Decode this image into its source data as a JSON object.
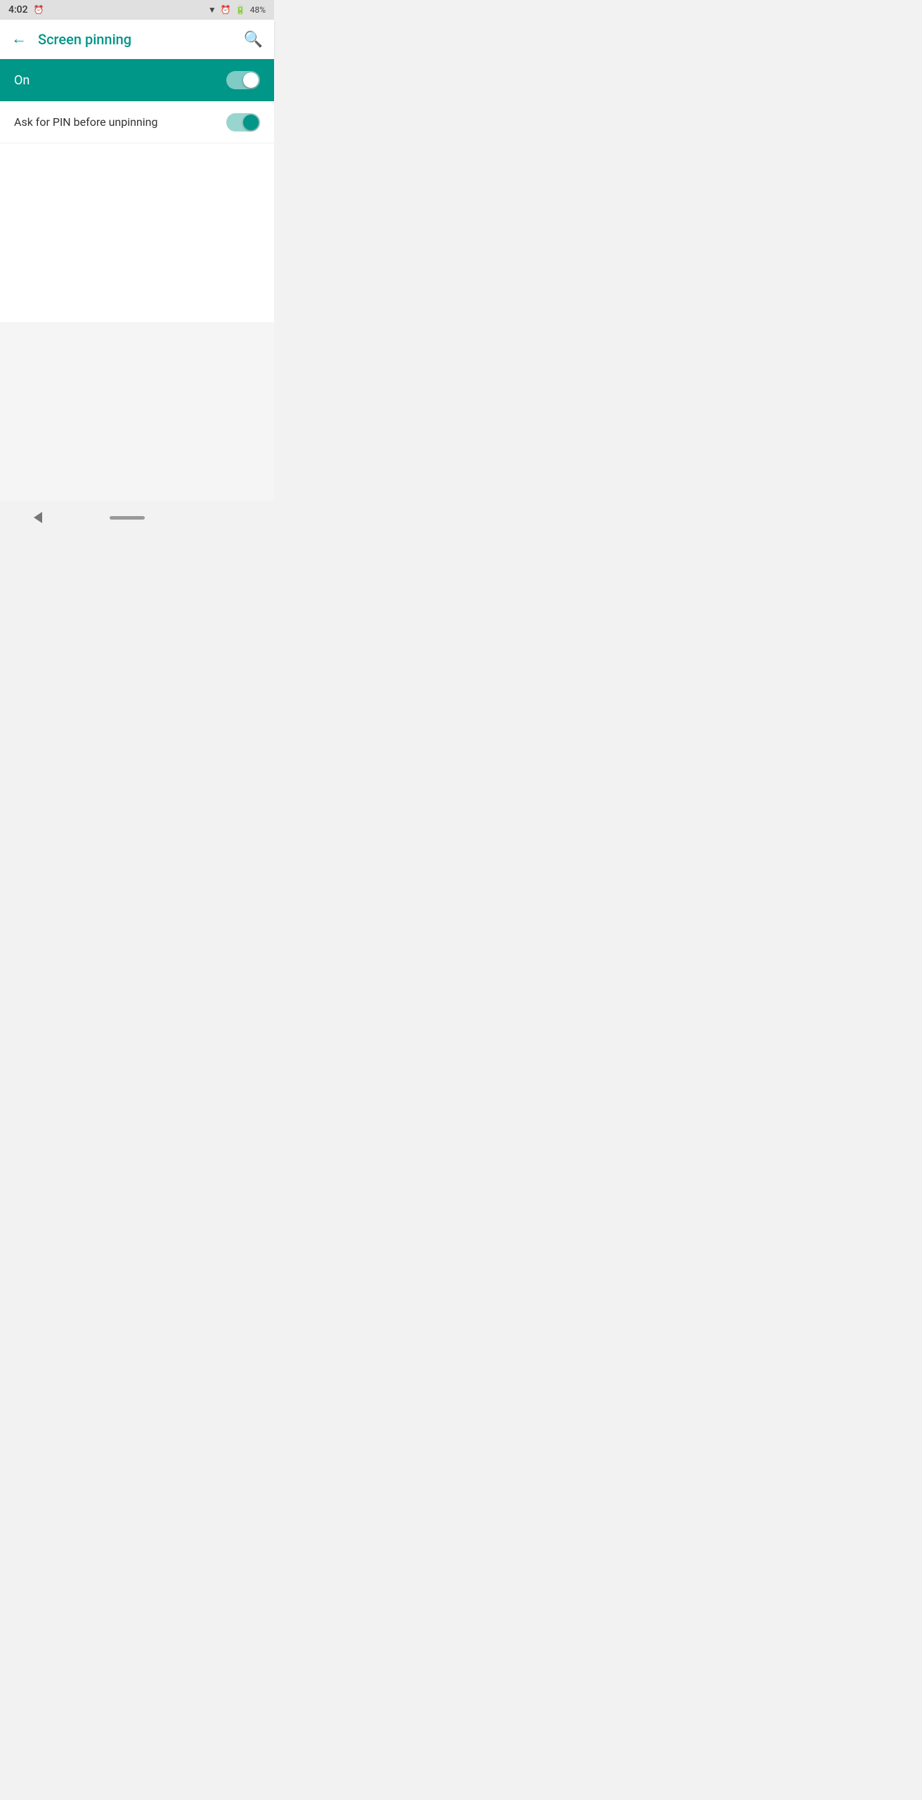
{
  "status_bar": {
    "time": "4:02",
    "battery_percent": "48%"
  },
  "app_bar": {
    "title": "Screen pinning",
    "back_label": "←",
    "search_label": "🔍"
  },
  "primary_toggle": {
    "label": "On",
    "is_on": true
  },
  "settings": [
    {
      "label": "Ask for PIN before unpinning",
      "is_on": true
    }
  ],
  "nav_bar": {}
}
